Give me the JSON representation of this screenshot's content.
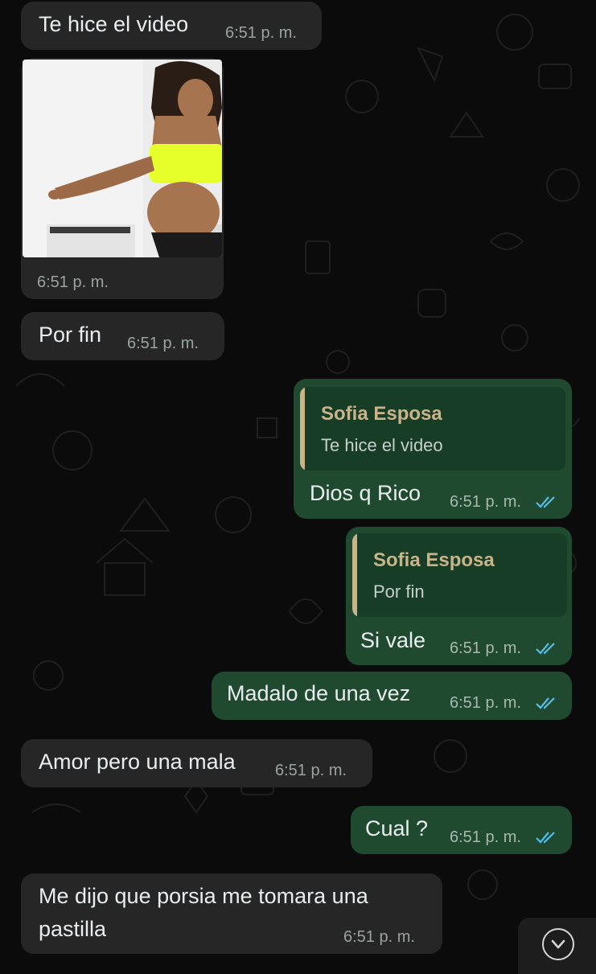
{
  "messages": [
    {
      "id": "m1",
      "direction": "incoming",
      "text": "Te hice el video",
      "time": "6:51 p. m."
    },
    {
      "id": "m2",
      "direction": "incoming",
      "type": "video",
      "time": "6:51 p. m."
    },
    {
      "id": "m3",
      "direction": "incoming",
      "text": "Por fin",
      "time": "6:51 p. m."
    },
    {
      "id": "m4",
      "direction": "outgoing",
      "quote_name": "Sofia Esposa",
      "quote_text": "Te hice el video",
      "text": "Dios q Rico",
      "time": "6:51 p. m.",
      "status": "read"
    },
    {
      "id": "m5",
      "direction": "outgoing",
      "quote_name": "Sofia Esposa",
      "quote_text": "Por fin",
      "text": "Si vale",
      "time": "6:51 p. m.",
      "status": "read"
    },
    {
      "id": "m6",
      "direction": "outgoing",
      "text": "Madalo de una vez",
      "time": "6:51 p. m.",
      "status": "read"
    },
    {
      "id": "m7",
      "direction": "incoming",
      "text": "Amor pero una mala",
      "time": "6:51 p. m."
    },
    {
      "id": "m8",
      "direction": "outgoing",
      "text": "Cual ?",
      "time": "6:51 p. m.",
      "status": "read"
    },
    {
      "id": "m9",
      "direction": "incoming",
      "text_line1": "Me dijo que porsia me tomara una",
      "text_line2": "pastilla",
      "time": "6:51 p. m."
    }
  ],
  "colors": {
    "background": "#0b0b0b",
    "incoming_bubble": "#262626",
    "outgoing_bubble": "#1f4a2f",
    "quote_name": "#c9b48a",
    "read_ticks": "#53bdeb"
  },
  "icons": {
    "read_receipt": "double-check-icon",
    "scroll_down": "chevron-down-icon"
  }
}
